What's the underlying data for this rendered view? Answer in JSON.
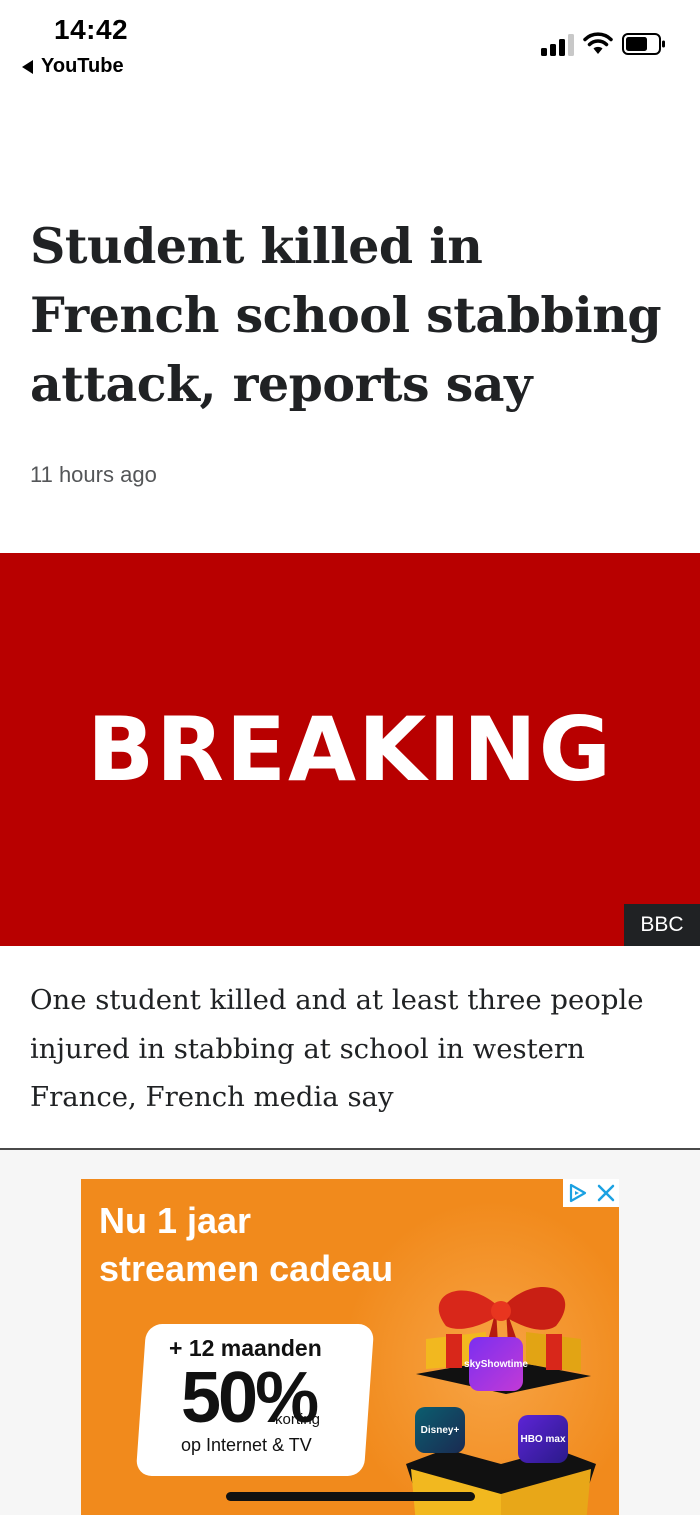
{
  "status_bar": {
    "time": "14:42",
    "back_app": "YouTube",
    "icons": [
      "cellular-signal-icon",
      "wifi-icon",
      "battery-icon"
    ]
  },
  "article": {
    "headline": "Student killed in French school stabbing attack, reports say",
    "timestamp": "11 hours ago",
    "image": {
      "text": "BREAKING",
      "credit": "BBC",
      "background": "#b80000"
    },
    "summary": "One student killed and at least three people injured in stabbing at school in western France, French media say"
  },
  "ad": {
    "title_line1": "Nu 1 jaar",
    "title_line2": "streamen cadeau",
    "offer_line1": "+ 12 maanden",
    "offer_big": "50%",
    "offer_small": "korting",
    "offer_line3": "op Internet & TV",
    "apps": [
      "skyShowtime",
      "Disney+",
      "HBO max"
    ],
    "background": "#f18a1c"
  }
}
